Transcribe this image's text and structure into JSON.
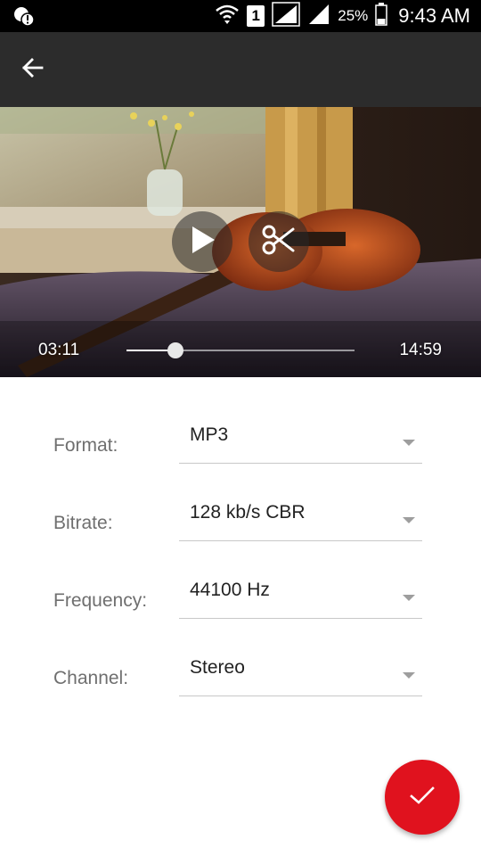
{
  "status_bar": {
    "sim_slot": "1",
    "battery_percent": "25%",
    "time": "9:43 AM"
  },
  "toolbar": {
    "back_icon": "arrow-back-icon"
  },
  "player": {
    "current_time": "03:11",
    "total_time": "14:59",
    "progress": 0.213,
    "play_icon": "play-icon",
    "cut_icon": "scissors-icon"
  },
  "settings": {
    "format": {
      "label": "Format:",
      "value": "MP3"
    },
    "bitrate": {
      "label": "Bitrate:",
      "value": "128 kb/s CBR"
    },
    "frequency": {
      "label": "Frequency:",
      "value": "44100 Hz"
    },
    "channel": {
      "label": "Channel:",
      "value": "Stereo"
    }
  },
  "fab": {
    "icon": "checkmark-icon",
    "color": "#e0121e"
  }
}
